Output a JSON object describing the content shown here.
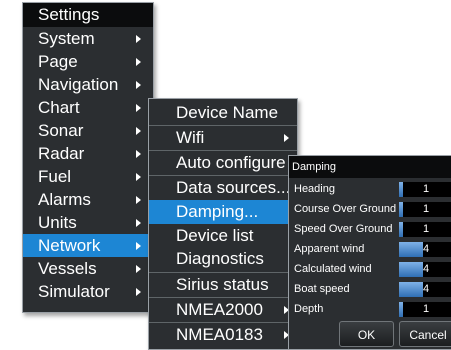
{
  "settings_menu": {
    "title": "Settings",
    "items": [
      {
        "label": "System",
        "submenu": true
      },
      {
        "label": "Page",
        "submenu": true
      },
      {
        "label": "Navigation",
        "submenu": true
      },
      {
        "label": "Chart",
        "submenu": true
      },
      {
        "label": "Sonar",
        "submenu": true
      },
      {
        "label": "Radar",
        "submenu": true
      },
      {
        "label": "Fuel",
        "submenu": true
      },
      {
        "label": "Alarms",
        "submenu": true
      },
      {
        "label": "Units",
        "submenu": true
      },
      {
        "label": "Network",
        "submenu": true,
        "selected": true
      },
      {
        "label": "Vessels",
        "submenu": true
      },
      {
        "label": "Simulator",
        "submenu": true
      }
    ]
  },
  "network_menu": {
    "items": [
      {
        "label": "Device Name"
      },
      {
        "label": "Wifi",
        "submenu": true
      },
      {
        "label": "Auto configure"
      },
      {
        "label": "Data sources..."
      },
      {
        "label": "Damping...",
        "selected": true
      },
      {
        "label": "Device list"
      },
      {
        "label": "Diagnostics"
      },
      {
        "label": "Sirius status"
      },
      {
        "label": "NMEA2000",
        "submenu": true
      },
      {
        "label": "NMEA0183",
        "submenu": true
      }
    ]
  },
  "damping_dialog": {
    "title": "Damping",
    "rows": [
      {
        "label": "Heading",
        "value": "1",
        "level": 1
      },
      {
        "label": "Course Over Ground",
        "value": "1",
        "level": 1
      },
      {
        "label": "Speed Over Ground",
        "value": "1",
        "level": 1
      },
      {
        "label": "Apparent wind",
        "value": "4",
        "level": 4
      },
      {
        "label": "Calculated wind",
        "value": "4",
        "level": 4
      },
      {
        "label": "Boat speed",
        "value": "4",
        "level": 4
      },
      {
        "label": "Depth",
        "value": "1",
        "level": 1
      }
    ],
    "ok_label": "OK",
    "cancel_label": "Cancel"
  },
  "colors": {
    "menu_bg": "#2b2e31",
    "title_bg": "#0b0c0d",
    "selection": "#1d86d4",
    "slider_fill": "#4f8fd4"
  }
}
